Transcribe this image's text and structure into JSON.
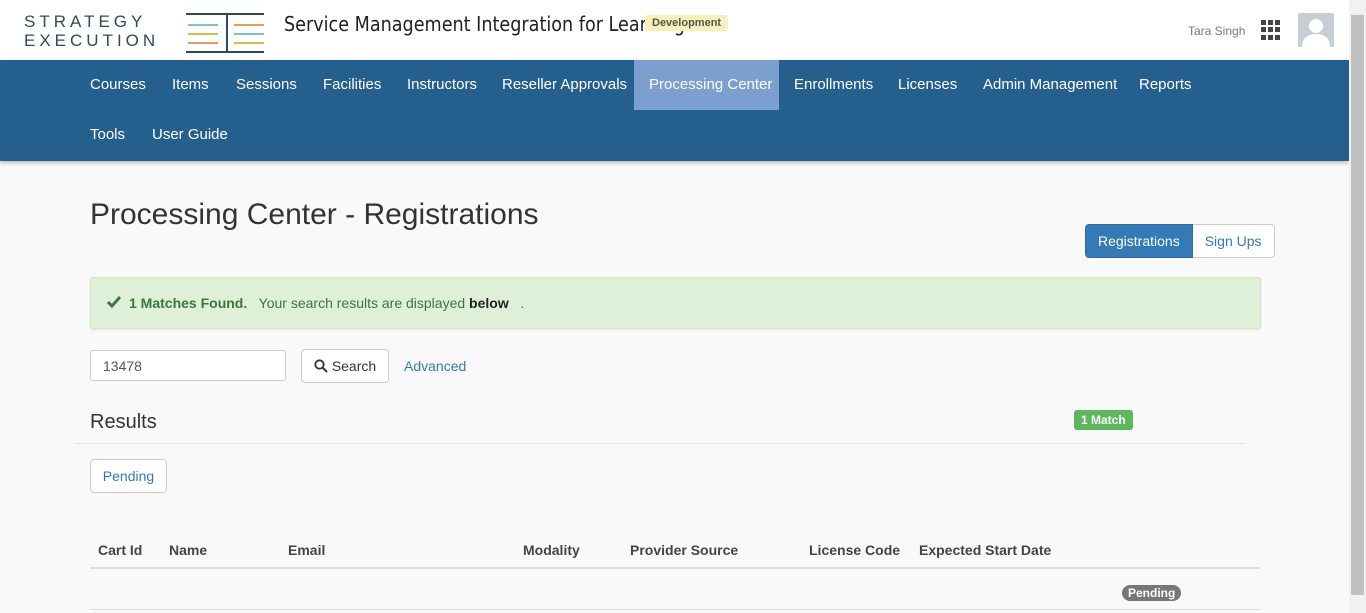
{
  "brand": {
    "logo_line1": "STRATEGY",
    "logo_line2": "EXECUTION",
    "app_title": "Service Management Integration for Learning",
    "env_badge": "Development"
  },
  "user": {
    "name": "Tara Singh"
  },
  "nav": {
    "items": [
      {
        "label": "Courses"
      },
      {
        "label": "Items"
      },
      {
        "label": "Sessions"
      },
      {
        "label": "Facilities"
      },
      {
        "label": "Instructors"
      },
      {
        "label": "Reseller Approvals"
      },
      {
        "label": "Processing Center"
      },
      {
        "label": "Enrollments"
      },
      {
        "label": "Licenses"
      },
      {
        "label": "Admin Management"
      },
      {
        "label": "Reports"
      },
      {
        "label": "Tools"
      },
      {
        "label": "User Guide"
      }
    ],
    "active": "Processing Center"
  },
  "page": {
    "title": "Processing Center - Registrations",
    "toggle": [
      "Registrations",
      "Sign Ups"
    ]
  },
  "alert": {
    "strong": "1 Matches Found.",
    "text": "Your search results are displayed",
    "emphasis": "below",
    "suffix": "."
  },
  "search": {
    "value": "13478",
    "button_label": "Search",
    "advanced_label": "Advanced"
  },
  "results": {
    "title": "Results",
    "match_badge": "1 Match",
    "filter_button": "Pending",
    "columns": [
      "Cart Id",
      "Name",
      "Email",
      "Modality",
      "Provider Source",
      "License Code",
      "Expected Start Date"
    ],
    "rows": [
      {
        "status": "Pending"
      }
    ]
  },
  "colors": {
    "nav_bg": "#245f8e",
    "nav_active": "#7ba0cf",
    "alert_bg": "#dff0d8",
    "primary": "#337ab7",
    "success": "#5cb85c"
  }
}
